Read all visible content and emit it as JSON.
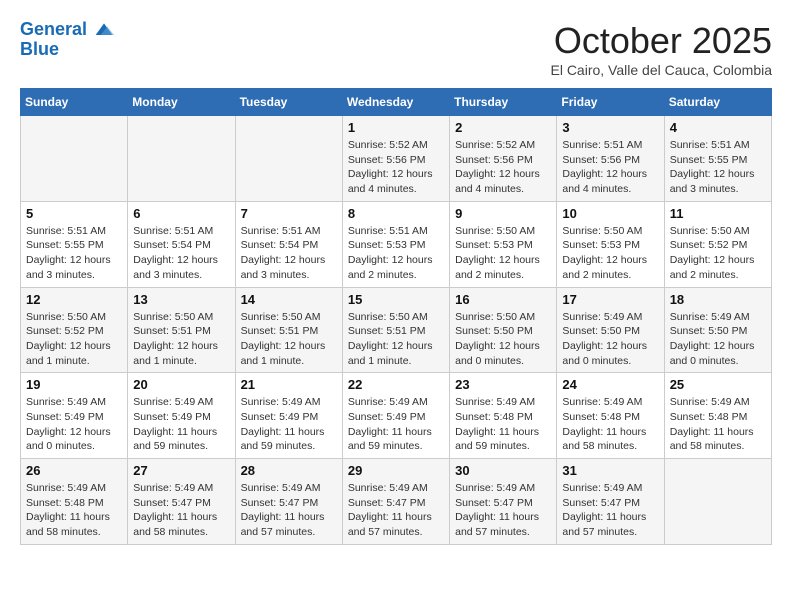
{
  "header": {
    "logo_line1": "General",
    "logo_line2": "Blue",
    "month_title": "October 2025",
    "subtitle": "El Cairo, Valle del Cauca, Colombia"
  },
  "weekdays": [
    "Sunday",
    "Monday",
    "Tuesday",
    "Wednesday",
    "Thursday",
    "Friday",
    "Saturday"
  ],
  "weeks": [
    [
      {
        "day": "",
        "detail": ""
      },
      {
        "day": "",
        "detail": ""
      },
      {
        "day": "",
        "detail": ""
      },
      {
        "day": "1",
        "detail": "Sunrise: 5:52 AM\nSunset: 5:56 PM\nDaylight: 12 hours\nand 4 minutes."
      },
      {
        "day": "2",
        "detail": "Sunrise: 5:52 AM\nSunset: 5:56 PM\nDaylight: 12 hours\nand 4 minutes."
      },
      {
        "day": "3",
        "detail": "Sunrise: 5:51 AM\nSunset: 5:56 PM\nDaylight: 12 hours\nand 4 minutes."
      },
      {
        "day": "4",
        "detail": "Sunrise: 5:51 AM\nSunset: 5:55 PM\nDaylight: 12 hours\nand 3 minutes."
      }
    ],
    [
      {
        "day": "5",
        "detail": "Sunrise: 5:51 AM\nSunset: 5:55 PM\nDaylight: 12 hours\nand 3 minutes."
      },
      {
        "day": "6",
        "detail": "Sunrise: 5:51 AM\nSunset: 5:54 PM\nDaylight: 12 hours\nand 3 minutes."
      },
      {
        "day": "7",
        "detail": "Sunrise: 5:51 AM\nSunset: 5:54 PM\nDaylight: 12 hours\nand 3 minutes."
      },
      {
        "day": "8",
        "detail": "Sunrise: 5:51 AM\nSunset: 5:53 PM\nDaylight: 12 hours\nand 2 minutes."
      },
      {
        "day": "9",
        "detail": "Sunrise: 5:50 AM\nSunset: 5:53 PM\nDaylight: 12 hours\nand 2 minutes."
      },
      {
        "day": "10",
        "detail": "Sunrise: 5:50 AM\nSunset: 5:53 PM\nDaylight: 12 hours\nand 2 minutes."
      },
      {
        "day": "11",
        "detail": "Sunrise: 5:50 AM\nSunset: 5:52 PM\nDaylight: 12 hours\nand 2 minutes."
      }
    ],
    [
      {
        "day": "12",
        "detail": "Sunrise: 5:50 AM\nSunset: 5:52 PM\nDaylight: 12 hours\nand 1 minute."
      },
      {
        "day": "13",
        "detail": "Sunrise: 5:50 AM\nSunset: 5:51 PM\nDaylight: 12 hours\nand 1 minute."
      },
      {
        "day": "14",
        "detail": "Sunrise: 5:50 AM\nSunset: 5:51 PM\nDaylight: 12 hours\nand 1 minute."
      },
      {
        "day": "15",
        "detail": "Sunrise: 5:50 AM\nSunset: 5:51 PM\nDaylight: 12 hours\nand 1 minute."
      },
      {
        "day": "16",
        "detail": "Sunrise: 5:50 AM\nSunset: 5:50 PM\nDaylight: 12 hours\nand 0 minutes."
      },
      {
        "day": "17",
        "detail": "Sunrise: 5:49 AM\nSunset: 5:50 PM\nDaylight: 12 hours\nand 0 minutes."
      },
      {
        "day": "18",
        "detail": "Sunrise: 5:49 AM\nSunset: 5:50 PM\nDaylight: 12 hours\nand 0 minutes."
      }
    ],
    [
      {
        "day": "19",
        "detail": "Sunrise: 5:49 AM\nSunset: 5:49 PM\nDaylight: 12 hours\nand 0 minutes."
      },
      {
        "day": "20",
        "detail": "Sunrise: 5:49 AM\nSunset: 5:49 PM\nDaylight: 11 hours\nand 59 minutes."
      },
      {
        "day": "21",
        "detail": "Sunrise: 5:49 AM\nSunset: 5:49 PM\nDaylight: 11 hours\nand 59 minutes."
      },
      {
        "day": "22",
        "detail": "Sunrise: 5:49 AM\nSunset: 5:49 PM\nDaylight: 11 hours\nand 59 minutes."
      },
      {
        "day": "23",
        "detail": "Sunrise: 5:49 AM\nSunset: 5:48 PM\nDaylight: 11 hours\nand 59 minutes."
      },
      {
        "day": "24",
        "detail": "Sunrise: 5:49 AM\nSunset: 5:48 PM\nDaylight: 11 hours\nand 58 minutes."
      },
      {
        "day": "25",
        "detail": "Sunrise: 5:49 AM\nSunset: 5:48 PM\nDaylight: 11 hours\nand 58 minutes."
      }
    ],
    [
      {
        "day": "26",
        "detail": "Sunrise: 5:49 AM\nSunset: 5:48 PM\nDaylight: 11 hours\nand 58 minutes."
      },
      {
        "day": "27",
        "detail": "Sunrise: 5:49 AM\nSunset: 5:47 PM\nDaylight: 11 hours\nand 58 minutes."
      },
      {
        "day": "28",
        "detail": "Sunrise: 5:49 AM\nSunset: 5:47 PM\nDaylight: 11 hours\nand 57 minutes."
      },
      {
        "day": "29",
        "detail": "Sunrise: 5:49 AM\nSunset: 5:47 PM\nDaylight: 11 hours\nand 57 minutes."
      },
      {
        "day": "30",
        "detail": "Sunrise: 5:49 AM\nSunset: 5:47 PM\nDaylight: 11 hours\nand 57 minutes."
      },
      {
        "day": "31",
        "detail": "Sunrise: 5:49 AM\nSunset: 5:47 PM\nDaylight: 11 hours\nand 57 minutes."
      },
      {
        "day": "",
        "detail": ""
      }
    ]
  ]
}
